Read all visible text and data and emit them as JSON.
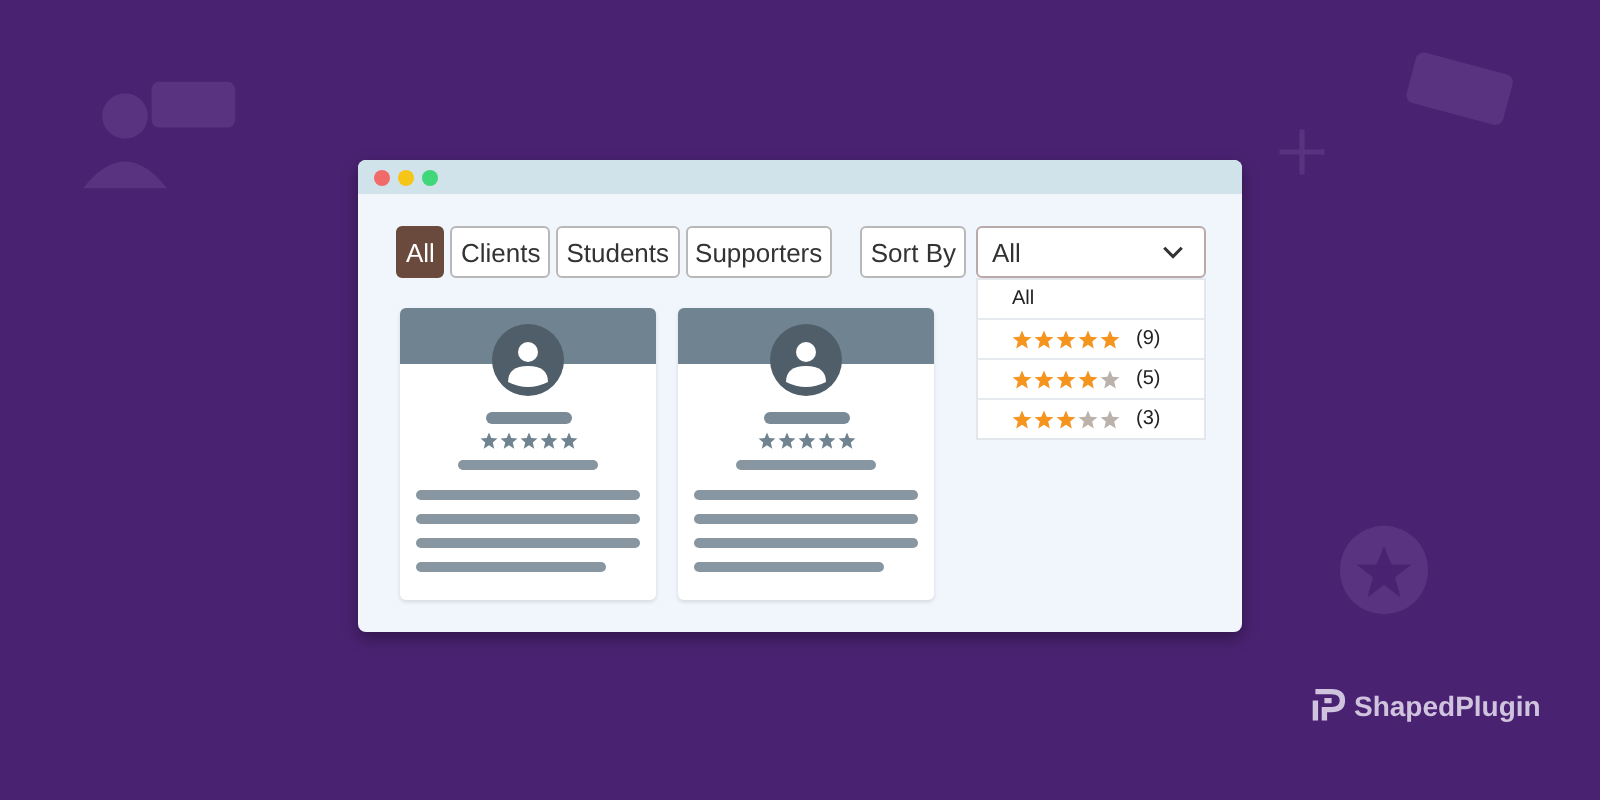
{
  "filters": [
    {
      "label": "All",
      "selected": true
    },
    {
      "label": "Clients",
      "selected": false
    },
    {
      "label": "Students",
      "selected": false
    },
    {
      "label": "Supporters",
      "selected": false
    }
  ],
  "sort": {
    "label": "Sort By",
    "value": "All",
    "expanded": true,
    "options": [
      {
        "kind": "text",
        "label": "All"
      },
      {
        "kind": "stars",
        "stars": 5,
        "count": "(9)"
      },
      {
        "kind": "stars",
        "stars": 4,
        "count": "(5)"
      },
      {
        "kind": "stars",
        "stars": 3,
        "count": "(3)"
      }
    ]
  },
  "cards": [
    {
      "stars": 5
    },
    {
      "stars": 5
    }
  ],
  "brand": {
    "name": "ShapedPlugin"
  }
}
